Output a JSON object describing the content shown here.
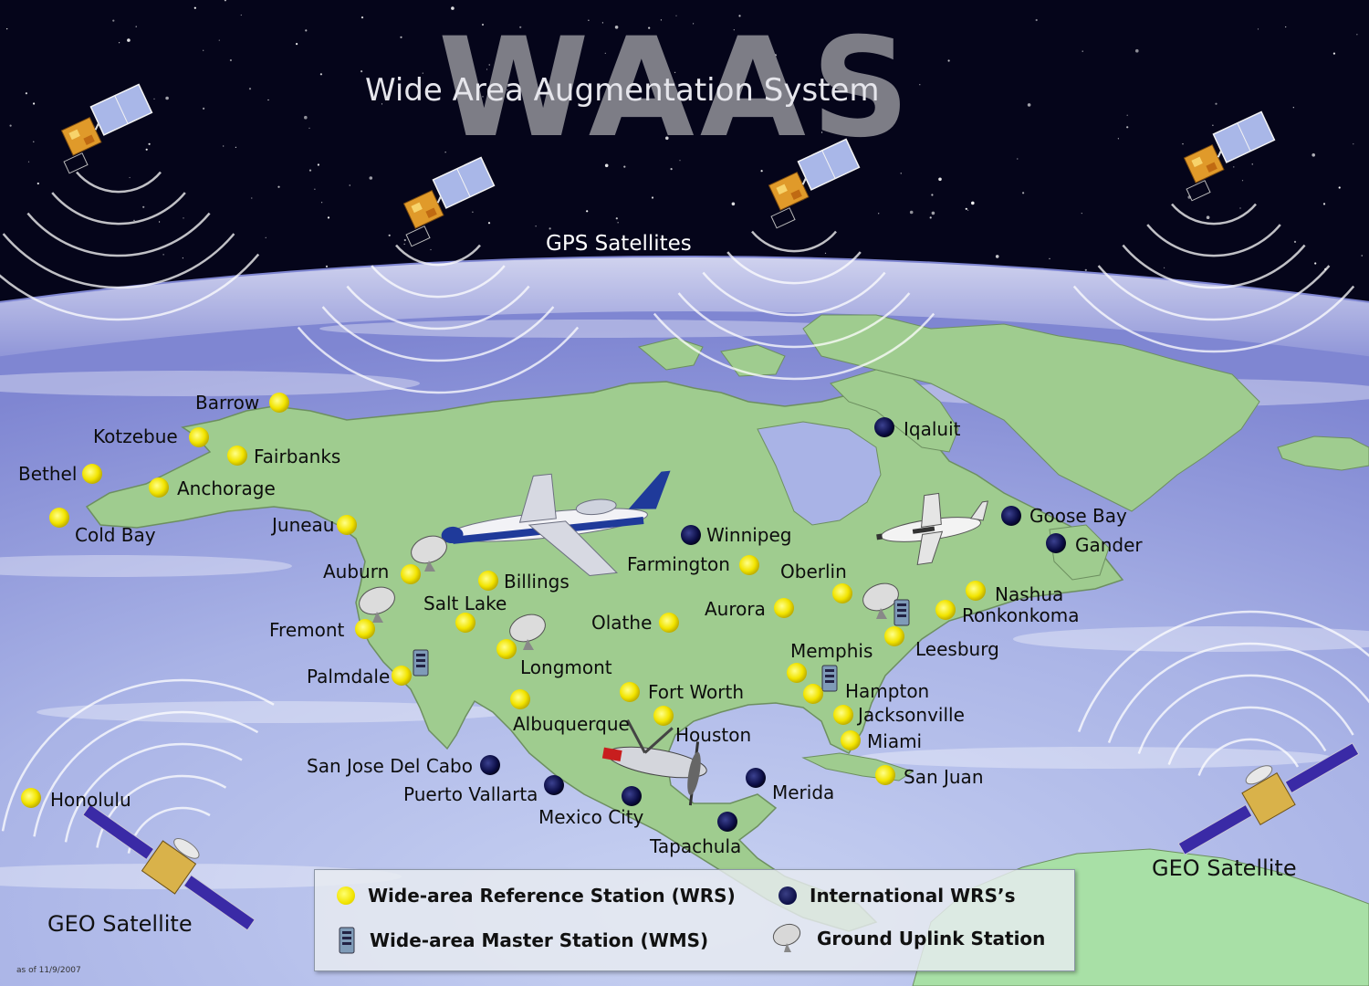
{
  "title": "WAAS",
  "subtitle": "Wide Area Augmentation System",
  "gps_label": "GPS Satellites",
  "geo_labels": [
    "GEO Satellite",
    "GEO Satellite"
  ],
  "as_of": "as of 11/9/2007",
  "colors": {
    "wrs": "#f2e400",
    "international_wrs": "#0b0d45",
    "land": "#9fcc8f",
    "space": "#05051a"
  },
  "legend": [
    {
      "symbol": "yellow-dot",
      "label": "Wide-area Reference Station (WRS)"
    },
    {
      "symbol": "navy-dot",
      "label": "International WRS’s"
    },
    {
      "symbol": "master-station-icon",
      "label": "Wide-area Master Station (WMS)"
    },
    {
      "symbol": "satellite-dish-icon",
      "label": "Ground Uplink Station"
    }
  ],
  "stations": [
    {
      "name": "Barrow",
      "type": "wrs"
    },
    {
      "name": "Kotzebue",
      "type": "wrs"
    },
    {
      "name": "Fairbanks",
      "type": "wrs"
    },
    {
      "name": "Bethel",
      "type": "wrs"
    },
    {
      "name": "Anchorage",
      "type": "wrs"
    },
    {
      "name": "Cold Bay",
      "type": "wrs"
    },
    {
      "name": "Juneau",
      "type": "wrs"
    },
    {
      "name": "Auburn",
      "type": "wrs"
    },
    {
      "name": "Billings",
      "type": "wrs"
    },
    {
      "name": "Salt Lake",
      "type": "wrs"
    },
    {
      "name": "Fremont",
      "type": "wrs"
    },
    {
      "name": "Palmdale",
      "type": "wrs"
    },
    {
      "name": "Longmont",
      "type": "wrs"
    },
    {
      "name": "Albuquerque",
      "type": "wrs"
    },
    {
      "name": "Fort Worth",
      "type": "wrs"
    },
    {
      "name": "Houston",
      "type": "wrs"
    },
    {
      "name": "Olathe",
      "type": "wrs"
    },
    {
      "name": "Farmington",
      "type": "wrs"
    },
    {
      "name": "Aurora",
      "type": "wrs"
    },
    {
      "name": "Oberlin",
      "type": "wrs"
    },
    {
      "name": "Memphis",
      "type": "wrs"
    },
    {
      "name": "Hampton",
      "type": "wrs"
    },
    {
      "name": "Jacksonville",
      "type": "wrs"
    },
    {
      "name": "Miami",
      "type": "wrs"
    },
    {
      "name": "San Juan",
      "type": "wrs"
    },
    {
      "name": "Leesburg",
      "type": "wrs"
    },
    {
      "name": "Ronkonkoma",
      "type": "wrs"
    },
    {
      "name": "Nashua",
      "type": "wrs"
    },
    {
      "name": "Honolulu",
      "type": "wrs"
    },
    {
      "name": "Iqaluit",
      "type": "international"
    },
    {
      "name": "Winnipeg",
      "type": "international"
    },
    {
      "name": "Goose Bay",
      "type": "international"
    },
    {
      "name": "Gander",
      "type": "international"
    },
    {
      "name": "San Jose Del Cabo",
      "type": "international"
    },
    {
      "name": "Puerto Vallarta",
      "type": "international"
    },
    {
      "name": "Mexico City",
      "type": "international"
    },
    {
      "name": "Merida",
      "type": "international"
    },
    {
      "name": "Tapachula",
      "type": "international"
    }
  ]
}
